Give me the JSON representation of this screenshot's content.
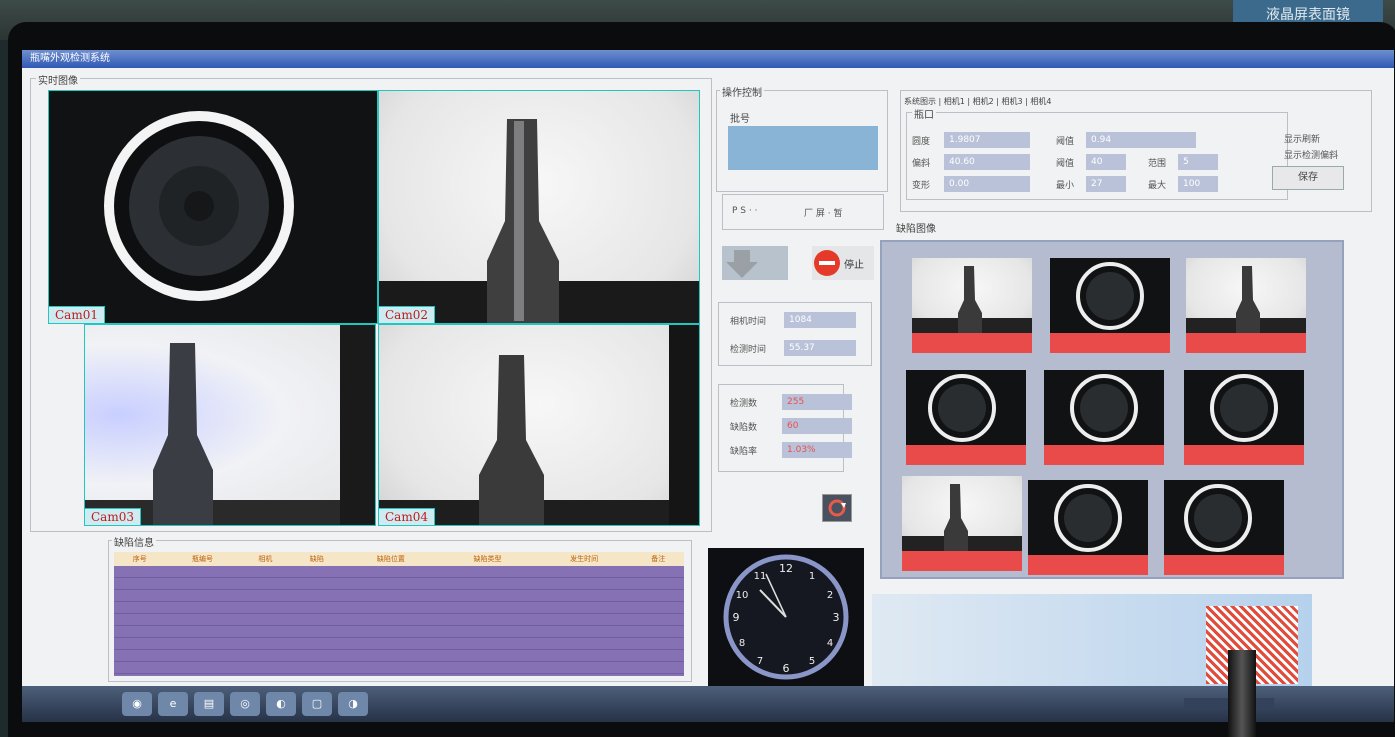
{
  "window": {
    "title": "瓶嘴外观检测系统"
  },
  "sign": {
    "text": "液晶屏表面镜"
  },
  "realtime": {
    "legend": "实时图像",
    "cams": [
      "Cam01",
      "Cam02",
      "Cam03",
      "Cam04"
    ]
  },
  "control": {
    "legend": "操作控制",
    "batch_legend": "批号",
    "mode_opt1": "P  S  ·  ·",
    "mode_opt2": "厂  屏  · 暂",
    "stop_label": "停止",
    "timing": [
      {
        "label": "相机时间",
        "value": "1084"
      },
      {
        "label": "检测时间",
        "value": "55.37"
      }
    ],
    "counts": [
      {
        "label": "检测数",
        "value": "255"
      },
      {
        "label": "缺陷数",
        "value": "60"
      },
      {
        "label": "缺陷率",
        "value": "1.03%"
      }
    ]
  },
  "settings": {
    "tabs": [
      "系统图示",
      "相机1",
      "相机2",
      "相机3",
      "相机4"
    ],
    "legend": "瓶口",
    "rows": [
      {
        "label": "圆度",
        "value": "1.9807"
      },
      {
        "label": "偏斜",
        "value": "40.60"
      },
      {
        "label": "变形",
        "value": "0.00"
      }
    ],
    "thresholds": [
      {
        "label": "阈值",
        "value": "0.94"
      },
      {
        "label": "阈值",
        "value": "40"
      },
      {
        "label": "最小",
        "value": "27"
      }
    ],
    "ranges": [
      {
        "label": "范围",
        "value": "5"
      },
      {
        "label": "最大",
        "value": "100"
      }
    ],
    "checks": [
      "显示刷新",
      "显示检测偏斜"
    ],
    "save_label": "保存"
  },
  "defects": {
    "legend": "缺陷图像"
  },
  "list": {
    "legend": "缺陷信息",
    "headers": [
      "序号",
      "瓶编号",
      "相机",
      "缺陷",
      "缺陷位置",
      "缺陷类型",
      "发生时间",
      "备注"
    ]
  },
  "colors": {
    "accent": "#1fc7bf",
    "defect_bar": "#e94a4a",
    "panel": "#b5bcd0"
  }
}
